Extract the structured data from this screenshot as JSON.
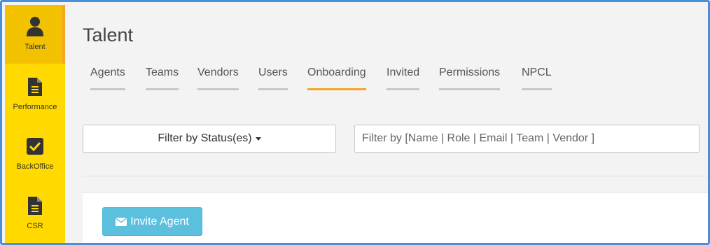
{
  "sidebar": {
    "items": [
      {
        "label": "Talent",
        "icon": "person-icon",
        "active": true
      },
      {
        "label": "Performance",
        "icon": "document-icon",
        "active": false
      },
      {
        "label": "BackOffice",
        "icon": "checkbox-icon",
        "active": false
      },
      {
        "label": "CSR",
        "icon": "document-icon",
        "active": false
      }
    ]
  },
  "main": {
    "title": "Talent",
    "tabs": [
      {
        "label": "Agents",
        "active": false
      },
      {
        "label": "Teams",
        "active": false
      },
      {
        "label": "Vendors",
        "active": false
      },
      {
        "label": "Users",
        "active": false
      },
      {
        "label": "Onboarding",
        "active": true
      },
      {
        "label": "Invited",
        "active": false
      },
      {
        "label": "Permissions",
        "active": false
      },
      {
        "label": "NPCL",
        "active": false
      }
    ],
    "filter_status_label": "Filter by Status(es)",
    "filter_search_placeholder": "Filter by [Name | Role | Email | Team | Vendor ]",
    "filter_search_value": "",
    "invite_button_label": "Invite Agent"
  },
  "colors": {
    "sidebar_bg": "#ffd900",
    "sidebar_active": "#f2c200",
    "active_tab_underline": "#f5a623",
    "invite_button": "#5bc0de",
    "frame_border": "#4a90d9"
  }
}
